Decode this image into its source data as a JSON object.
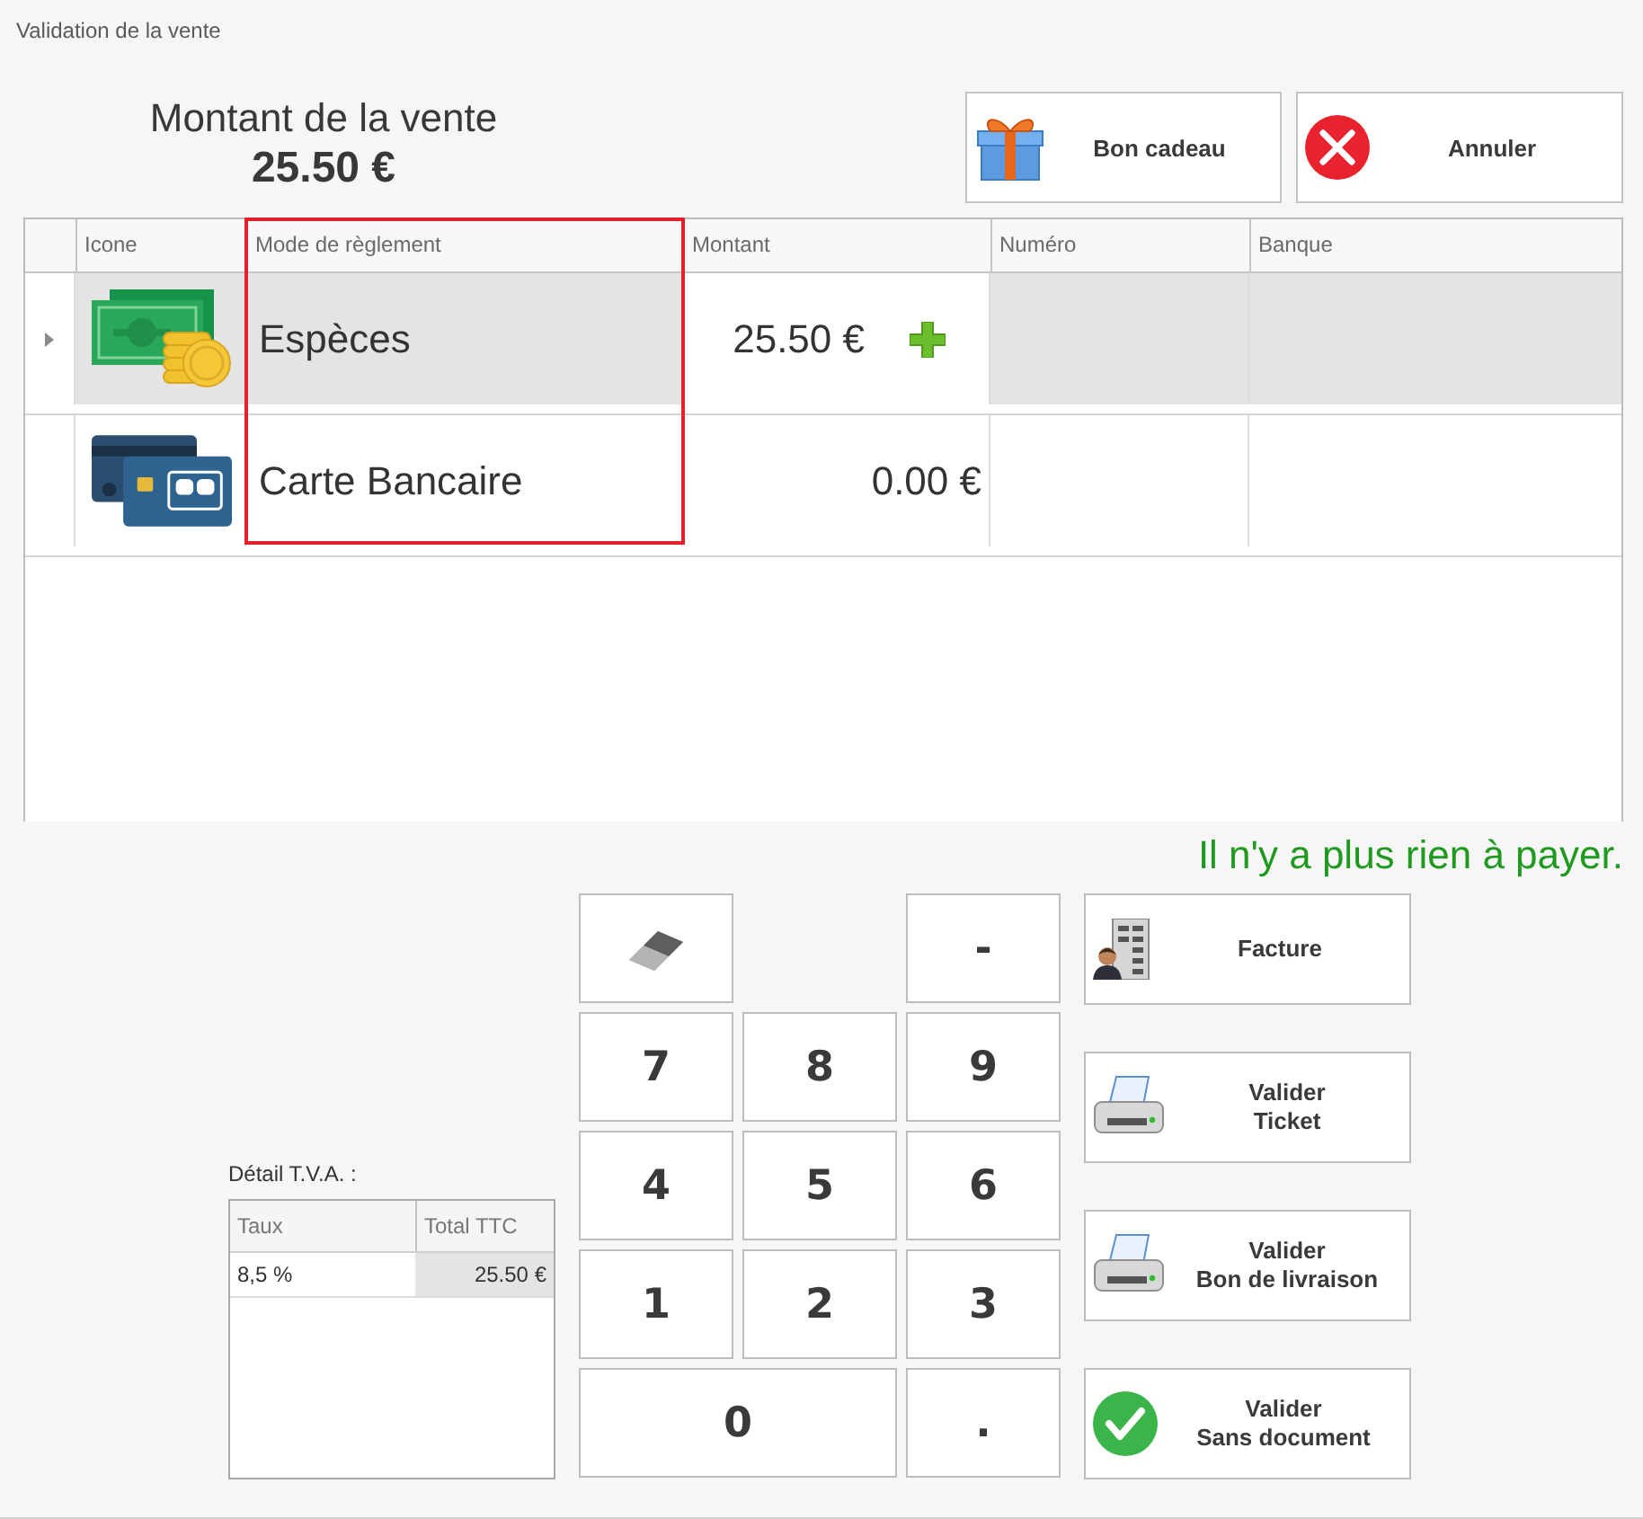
{
  "window": {
    "title": "Validation de la vente"
  },
  "sale": {
    "label": "Montant de la vente",
    "total": "25.50 €"
  },
  "top_buttons": [
    {
      "kind": "gift",
      "label": "Bon cadeau"
    },
    {
      "kind": "cancel",
      "label": "Annuler"
    }
  ],
  "payments": {
    "columns": [
      {
        "label": "Icone",
        "highlighted": false
      },
      {
        "label": "Mode de règlement",
        "highlighted": true
      },
      {
        "label": "Montant",
        "highlighted": false
      },
      {
        "label": "Numéro",
        "highlighted": false
      },
      {
        "label": "Banque",
        "highlighted": false
      }
    ],
    "rows": [
      {
        "kind": "cash",
        "mode": "Espèces",
        "amount": "25.50 €",
        "selected": true
      },
      {
        "kind": "card",
        "mode": "Carte Bancaire",
        "amount": "0.00 €",
        "selected": false
      }
    ]
  },
  "status_message": "Il n'y a plus rien à payer.",
  "vat": {
    "title": "Détail T.V.A. :",
    "columns": [
      "Taux",
      "Total TTC"
    ],
    "rows": [
      {
        "rate": "8,5 %",
        "total": "25.50 €"
      }
    ]
  },
  "keypad": {
    "keys": [
      {
        "kind": "eraser",
        "wide": false
      },
      {
        "kind": "char",
        "label": "-",
        "wide": false
      },
      {
        "kind": "char",
        "label": "7",
        "wide": false
      },
      {
        "kind": "char",
        "label": "8",
        "wide": false
      },
      {
        "kind": "char",
        "label": "9",
        "wide": false
      },
      {
        "kind": "char",
        "label": "4",
        "wide": false
      },
      {
        "kind": "char",
        "label": "5",
        "wide": false
      },
      {
        "kind": "char",
        "label": "6",
        "wide": false
      },
      {
        "kind": "char",
        "label": "1",
        "wide": false
      },
      {
        "kind": "char",
        "label": "2",
        "wide": false
      },
      {
        "kind": "char",
        "label": "3",
        "wide": false
      },
      {
        "kind": "char",
        "label": "0",
        "wide": true
      },
      {
        "kind": "char",
        "label": ".",
        "wide": false
      }
    ]
  },
  "actions": [
    {
      "kind": "invoice",
      "label": "Facture"
    },
    {
      "kind": "printer",
      "label": "Valider\nTicket"
    },
    {
      "kind": "printer",
      "label": "Valider\nBon de livraison"
    },
    {
      "kind": "check",
      "label": "Valider\nSans document"
    }
  ]
}
